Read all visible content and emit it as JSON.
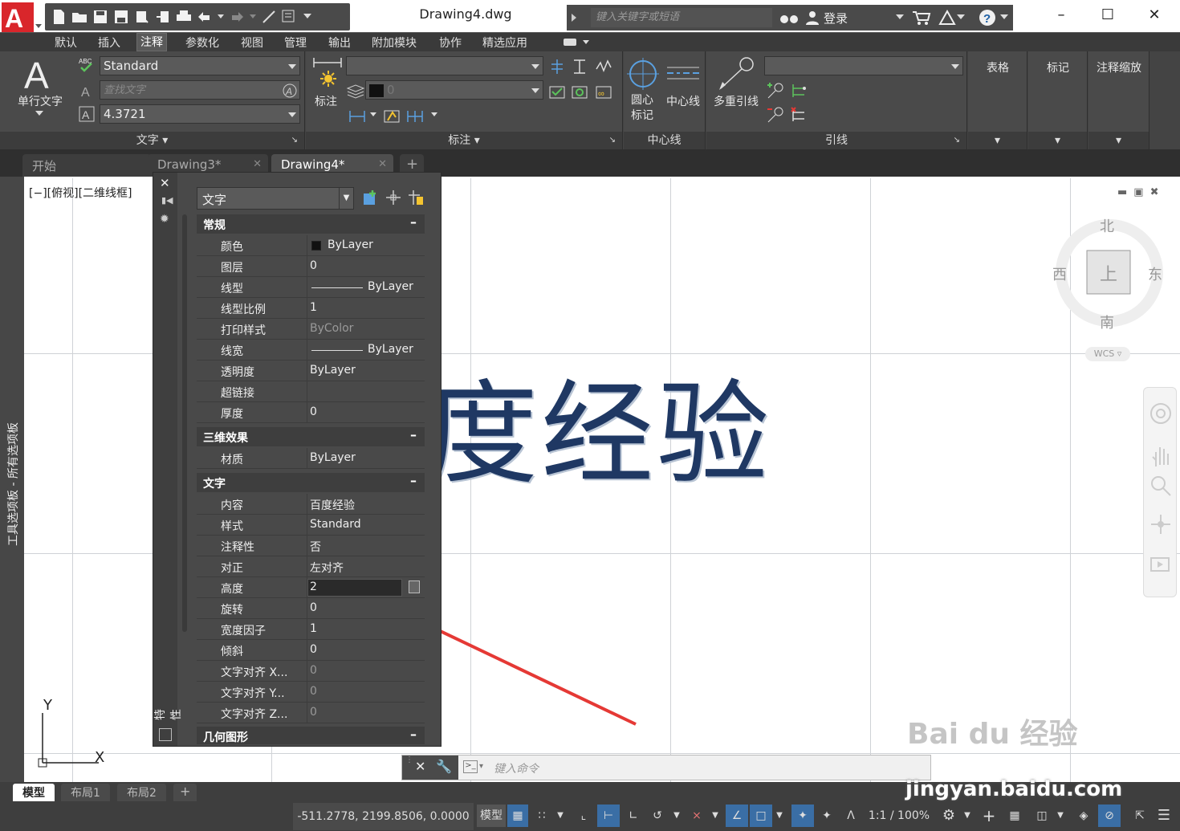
{
  "window": {
    "title": "Drawing4.dwg",
    "search_placeholder": "键入关键字或短语",
    "login_label": "登录"
  },
  "menu": [
    "默认",
    "插入",
    "注释",
    "参数化",
    "视图",
    "管理",
    "输出",
    "附加模块",
    "协作",
    "精选应用"
  ],
  "menu_active": "注释",
  "ribbon": {
    "text_panel": {
      "big_button": "单行文字",
      "style_value": "Standard",
      "find_placeholder": "查找文字",
      "height_value": "4.3721",
      "title": "文字"
    },
    "dim_panel": {
      "big_button": "标注",
      "layer_value": "0",
      "title": "标注"
    },
    "center_panel": {
      "button1_line1": "圆心",
      "button1_line2": "标记",
      "button2": "中心线",
      "title": "中心线"
    },
    "leader_panel": {
      "big_button": "多重引线",
      "title": "引线"
    },
    "table_panel": {
      "label": "表格"
    },
    "mark_panel": {
      "label": "标记"
    },
    "scale_panel": {
      "label": "注释缩放"
    }
  },
  "tabs": {
    "start": "开始",
    "drawing3": "Drawing3*",
    "drawing4": "Drawing4*"
  },
  "canvas": {
    "viewport_label": "[−][俯视][二维线框]",
    "big_text": "度经验",
    "ucs_y": "Y",
    "ucs_x": "X",
    "tool_palette_label": "工具选项板 - 所有选项板"
  },
  "viewcube": {
    "north": "北",
    "south": "南",
    "east": "东",
    "west": "西",
    "top": "上",
    "wcs": "WCS"
  },
  "properties": {
    "object_type": "文字",
    "vertical_title": "特性",
    "sections": {
      "general": "常规",
      "effects3d": "三维效果",
      "text": "文字",
      "geometry": "几何图形"
    },
    "general_rows": [
      {
        "k": "颜色",
        "v": "ByLayer"
      },
      {
        "k": "图层",
        "v": "0"
      },
      {
        "k": "线型",
        "v": "ByLayer"
      },
      {
        "k": "线型比例",
        "v": "1"
      },
      {
        "k": "打印样式",
        "v": "ByColor"
      },
      {
        "k": "线宽",
        "v": "ByLayer"
      },
      {
        "k": "透明度",
        "v": "ByLayer"
      },
      {
        "k": "超链接",
        "v": ""
      },
      {
        "k": "厚度",
        "v": "0"
      }
    ],
    "effects_rows": [
      {
        "k": "材质",
        "v": "ByLayer"
      }
    ],
    "text_rows": [
      {
        "k": "内容",
        "v": "百度经验"
      },
      {
        "k": "样式",
        "v": "Standard"
      },
      {
        "k": "注释性",
        "v": "否"
      },
      {
        "k": "对正",
        "v": "左对齐"
      },
      {
        "k": "高度",
        "v": "2"
      },
      {
        "k": "旋转",
        "v": "0"
      },
      {
        "k": "宽度因子",
        "v": "1"
      },
      {
        "k": "倾斜",
        "v": "0"
      },
      {
        "k": "文字对齐 X...",
        "v": "0"
      },
      {
        "k": "文字对齐 Y...",
        "v": "0"
      },
      {
        "k": "文字对齐 Z...",
        "v": "0"
      }
    ]
  },
  "command": {
    "placeholder": "键入命令"
  },
  "layout_tabs": [
    "模型",
    "布局1",
    "布局2"
  ],
  "status": {
    "coords": "-511.2778, 2199.8506, 0.0000",
    "model": "模型",
    "scale": "1:1 / 100%"
  },
  "watermark": {
    "logo": "Bai du 经验",
    "url": "jingyan.baidu.com"
  },
  "colors": {
    "accent_red": "#e8383d",
    "text_blue": "#1f3863",
    "arrow": "#e53935"
  }
}
